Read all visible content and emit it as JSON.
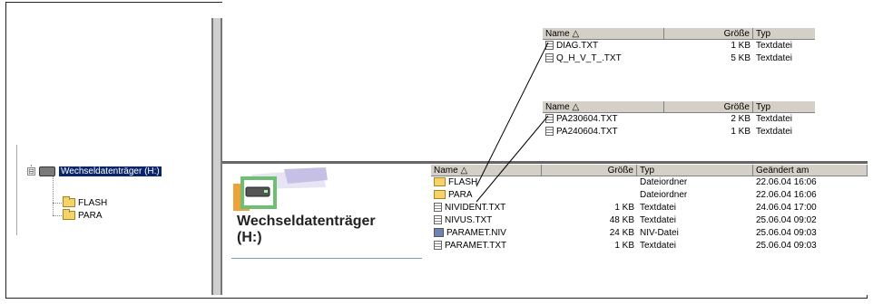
{
  "tree": {
    "drive_label": "Wechseldatenträger (H:)",
    "expander_symbol": "⊟",
    "children": [
      "FLASH",
      "PARA"
    ]
  },
  "top_list_1": {
    "headers": {
      "name": "Name",
      "size": "Größe",
      "type": "Typ"
    },
    "rows": [
      {
        "name": "DIAG.TXT",
        "size": "1 KB",
        "type": "Textdatei"
      },
      {
        "name": "Q_H_V_T_.TXT",
        "size": "5 KB",
        "type": "Textdatei"
      }
    ]
  },
  "top_list_2": {
    "headers": {
      "name": "Name",
      "size": "Größe",
      "type": "Typ"
    },
    "rows": [
      {
        "name": "PA230604.TXT",
        "size": "2 KB",
        "type": "Textdatei"
      },
      {
        "name": "PA240604.TXT",
        "size": "1 KB",
        "type": "Textdatei"
      }
    ]
  },
  "banner": {
    "title_line1": "Wechseldatenträger",
    "title_line2": "(H:)"
  },
  "main_list": {
    "headers": {
      "name": "Name",
      "size": "Größe",
      "type": "Typ",
      "modified": "Geändert am"
    },
    "rows": [
      {
        "icon": "folder-icon",
        "name": "FLASH",
        "size": "",
        "type": "Dateiordner",
        "modified": "22.06.04 16:06"
      },
      {
        "icon": "folder-icon",
        "name": "PARA",
        "size": "",
        "type": "Dateiordner",
        "modified": "22.06.04 16:06"
      },
      {
        "icon": "text-file-icon",
        "name": "NIVIDENT.TXT",
        "size": "1 KB",
        "type": "Textdatei",
        "modified": "24.06.04 17:00"
      },
      {
        "icon": "text-file-icon",
        "name": "NIVUS.TXT",
        "size": "48 KB",
        "type": "Textdatei",
        "modified": "25.06.04 09:02"
      },
      {
        "icon": "niv-file-icon",
        "name": "PARAMET.NIV",
        "size": "24 KB",
        "type": "NIV-Datei",
        "modified": "25.06.04 09:03"
      },
      {
        "icon": "text-file-icon",
        "name": "PARAMET.TXT",
        "size": "1 KB",
        "type": "Textdatei",
        "modified": "25.06.04 09:03"
      }
    ]
  }
}
